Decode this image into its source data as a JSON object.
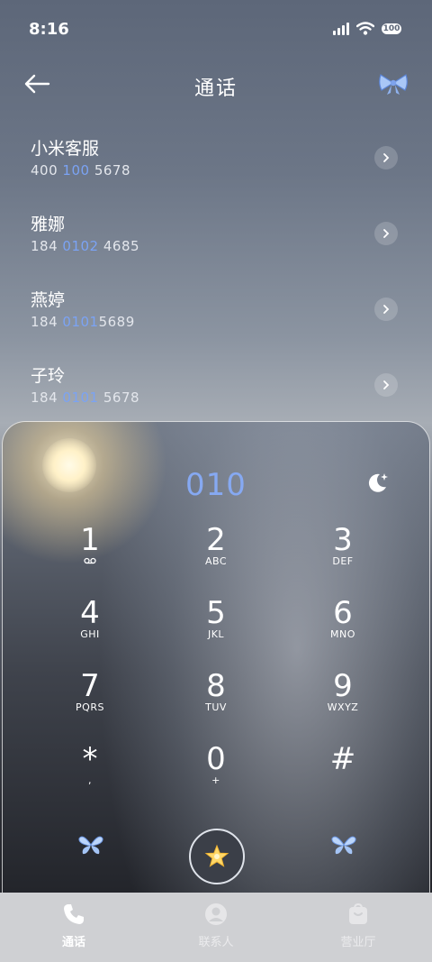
{
  "status_bar": {
    "time": "8:16",
    "battery": "100"
  },
  "header": {
    "title": "通话",
    "back_icon": "arrow-left-icon",
    "right_icon": "bow-icon"
  },
  "contacts": [
    {
      "name": "小米客服",
      "number_parts": [
        "400 ",
        "100",
        " 5678"
      ],
      "hl_index": 1
    },
    {
      "name": "雅娜",
      "number_parts": [
        "184 ",
        "0102",
        " 4685"
      ],
      "hl_index": 1
    },
    {
      "name": "燕婷",
      "number_parts": [
        "184 ",
        "0101",
        "5689"
      ],
      "hl_index": 1
    },
    {
      "name": "子玲",
      "number_parts": [
        "184 ",
        "0101",
        " 5678"
      ],
      "hl_index": 1
    }
  ],
  "dialer": {
    "input_value": "010",
    "keys": [
      {
        "digit": "1",
        "letters": "ᴼᴼ"
      },
      {
        "digit": "2",
        "letters": "ABC"
      },
      {
        "digit": "3",
        "letters": "DEF"
      },
      {
        "digit": "4",
        "letters": "GHI"
      },
      {
        "digit": "5",
        "letters": "JKL"
      },
      {
        "digit": "6",
        "letters": "MNO"
      },
      {
        "digit": "7",
        "letters": "PQRS"
      },
      {
        "digit": "8",
        "letters": "TUV"
      },
      {
        "digit": "9",
        "letters": "WXYZ"
      },
      {
        "digit": "*",
        "letters": ","
      },
      {
        "digit": "0",
        "letters": "+"
      },
      {
        "digit": "#",
        "letters": ""
      }
    ],
    "accent": "#7ba3f4"
  },
  "tabs": [
    {
      "label": "通话",
      "icon": "phone-icon",
      "active": true
    },
    {
      "label": "联系人",
      "icon": "person-icon",
      "active": false
    },
    {
      "label": "营业厅",
      "icon": "shop-bag-icon",
      "active": false
    }
  ]
}
